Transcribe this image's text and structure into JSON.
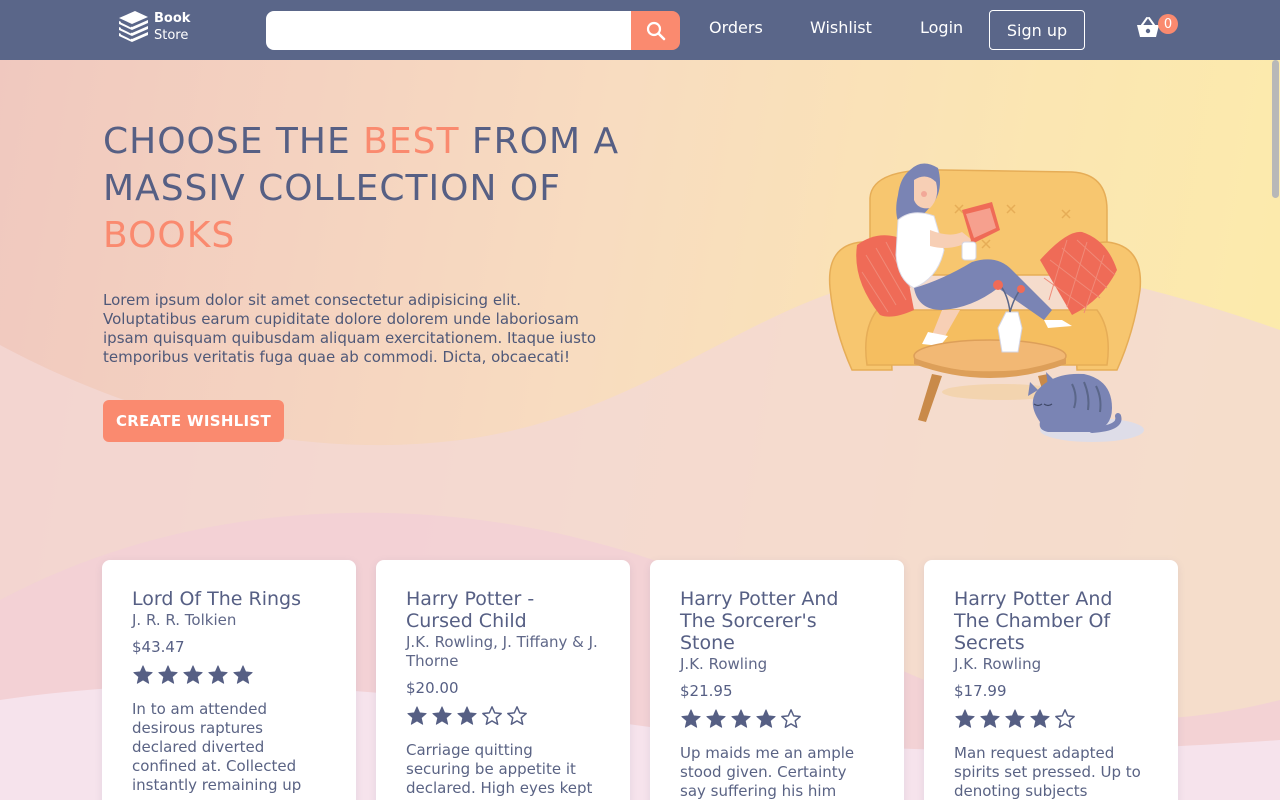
{
  "brand": {
    "line1": "Book",
    "line2": "Store"
  },
  "search": {
    "placeholder": "",
    "value": ""
  },
  "nav": {
    "orders": "Orders",
    "wishlist": "Wishlist",
    "login": "Login",
    "signup": "Sign up"
  },
  "cart": {
    "count": "0"
  },
  "hero": {
    "title_part1": "CHOOSE THE ",
    "title_accent1": "BEST",
    "title_part2": " FROM A MASSIV COLLECTION OF ",
    "title_accent2": "BOOKS",
    "description": "Lorem ipsum dolor sit amet consectetur adipisicing elit. Voluptatibus earum cupiditate dolore dolorem unde laboriosam ipsam quisquam quibusdam aliquam exercitationem. Itaque iusto temporibus veritatis fuga quae ab commodi. Dicta, obcaecati!",
    "cta": "CREATE WISHLIST"
  },
  "books": [
    {
      "title": "Lord Of The Rings",
      "author": "J. R. R. Tolkien",
      "price": "$43.47",
      "rating": 5,
      "description": "In to am attended desirous raptures declared diverted confined at. Collected instantly remaining up"
    },
    {
      "title": "Harry Potter - Cursed Child",
      "author": "J.K. Rowling, J. Tiffany & J. Thorne",
      "price": "$20.00",
      "rating": 3,
      "description": "Carriage quitting securing be appetite it declared. High eyes kept so busy"
    },
    {
      "title": "Harry Potter And The Sorcerer's Stone",
      "author": "J.K. Rowling",
      "price": "$21.95",
      "rating": 4,
      "description": "Up maids me an ample stood given. Certainty say suffering his him collected intention promotion. Hill"
    },
    {
      "title": "Harry Potter And The Chamber Of Secrets",
      "author": "J.K. Rowling",
      "price": "$17.99",
      "rating": 4,
      "description": "Man request adapted spirits set pressed. Up to denoting subjects sensible feelings it indulged"
    }
  ],
  "colors": {
    "navbar": "#5a6689",
    "accent": "#fa8a6f",
    "text": "#565f84",
    "star": "#565f84"
  },
  "icons": {
    "logo": "books-stack-icon",
    "search": "search-icon",
    "cart": "basket-icon",
    "star_filled": "star-filled-icon",
    "star_empty": "star-outline-icon"
  }
}
